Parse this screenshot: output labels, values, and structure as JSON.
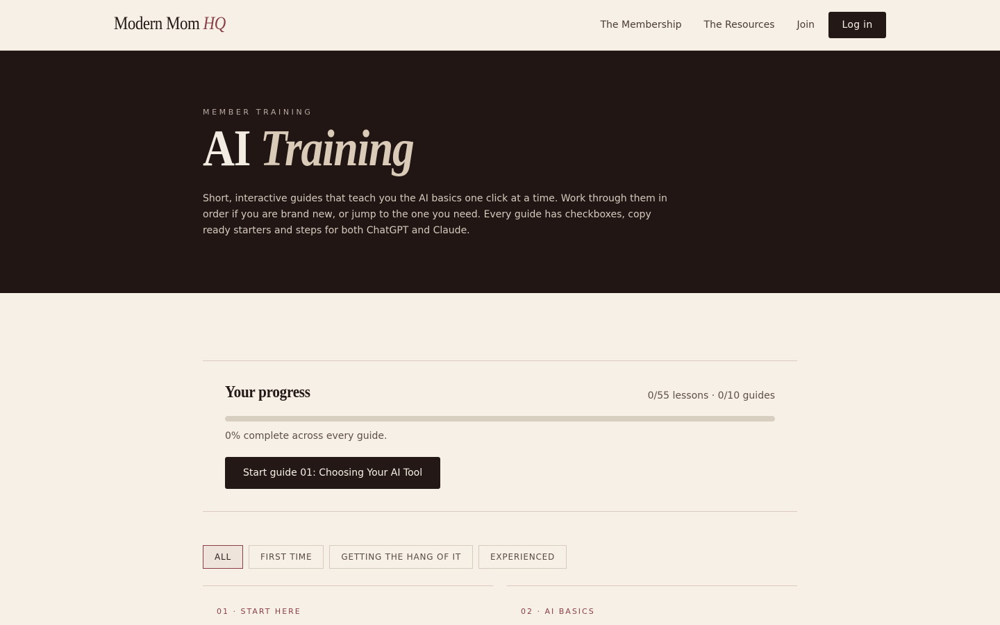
{
  "header": {
    "logo_main": "Modern Mom",
    "logo_accent": "HQ",
    "nav": [
      "The Membership",
      "The Resources",
      "Join"
    ],
    "login_label": "Log in"
  },
  "hero": {
    "eyebrow": "MEMBER TRAINING",
    "title_main": "AI",
    "title_accent": "Training",
    "description": "Short, interactive guides that teach you the AI basics one click at a time. Work through them in order if you are brand new, or jump to the one you need. Every guide has checkboxes, copy ready starters and steps for both ChatGPT and Claude."
  },
  "progress": {
    "title": "Your progress",
    "counts": "0/55 lessons · 0/10 guides",
    "percent": 0,
    "note": "0% complete across every guide.",
    "start_label": "Start guide 01: Choosing Your AI Tool"
  },
  "filters": [
    {
      "label": "ALL",
      "active": true
    },
    {
      "label": "FIRST TIME",
      "active": false
    },
    {
      "label": "GETTING THE HANG OF IT",
      "active": false
    },
    {
      "label": "EXPERIENCED",
      "active": false
    }
  ],
  "guides": [
    {
      "tag": "01 · START HERE"
    },
    {
      "tag": "02 · AI BASICS"
    }
  ],
  "colors": {
    "background": "#f6f0e6",
    "dark": "#211614",
    "accent": "#8a3f45"
  }
}
